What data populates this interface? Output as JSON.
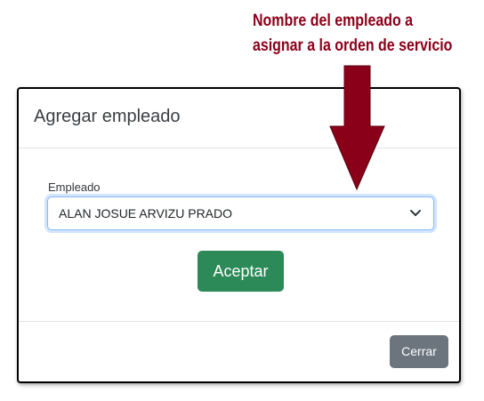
{
  "annotation": {
    "line1": "Nombre del empleado a",
    "line2": "asignar a la orden de servicio",
    "color": "#8b0019"
  },
  "modal": {
    "title": "Agregar empleado",
    "field_label": "Empleado",
    "selected_employee": "ALAN JOSUE ARVIZU PRADO",
    "accept_label": "Aceptar",
    "close_label": "Cerrar"
  },
  "colors": {
    "accept": "#2b8a57",
    "close": "#6c757d",
    "focus": "#86b7fe"
  }
}
